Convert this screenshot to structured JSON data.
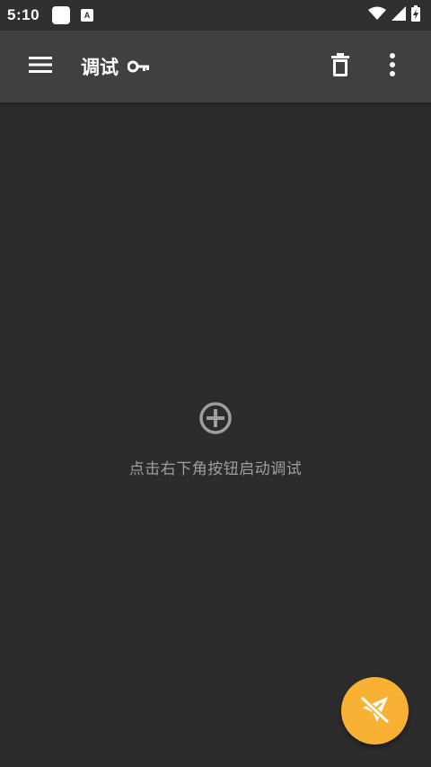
{
  "status_bar": {
    "time": "5:10",
    "notification_badge": "A",
    "icons": [
      "rounded-square-icon",
      "a-notification-icon",
      "wifi-icon",
      "signal-icon",
      "battery-charging-icon"
    ]
  },
  "app_bar": {
    "title": "调试",
    "icons": [
      "menu-icon",
      "key-icon",
      "delete-icon",
      "more-vert-icon"
    ]
  },
  "empty_state": {
    "message": "点击右下角按钮启动调试",
    "icon": "add-circle-icon"
  },
  "fab": {
    "icon": "send-off-icon"
  },
  "colors": {
    "status_bar": "#303030",
    "app_bar": "#404040",
    "background": "#2c2c2c",
    "empty_text": "#9e9e9e",
    "fab": "#f8b133"
  }
}
